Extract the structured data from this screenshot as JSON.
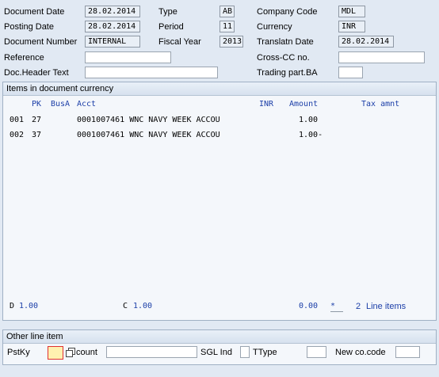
{
  "header": {
    "document_date": {
      "label": "Document Date",
      "value": "28.02.2014"
    },
    "posting_date": {
      "label": "Posting Date",
      "value": "28.02.2014"
    },
    "document_number": {
      "label": "Document Number",
      "value": "INTERNAL"
    },
    "reference": {
      "label": "Reference",
      "value": ""
    },
    "doc_header_text": {
      "label": "Doc.Header Text",
      "value": ""
    },
    "type": {
      "label": "Type",
      "value": "AB"
    },
    "period": {
      "label": "Period",
      "value": "11"
    },
    "fiscal_year": {
      "label": "Fiscal Year",
      "value": "2013"
    },
    "company_code": {
      "label": "Company Code",
      "value": "MDL"
    },
    "currency": {
      "label": "Currency",
      "value": "INR"
    },
    "translatn_date": {
      "label": "Translatn Date",
      "value": "28.02.2014"
    },
    "cross_cc": {
      "label": "Cross-CC no.",
      "value": ""
    },
    "trading_part": {
      "label": "Trading part.BA",
      "value": ""
    }
  },
  "items_panel": {
    "title": "Items in document currency",
    "columns": {
      "pk": "PK",
      "busa": "BusA",
      "acct": "Acct",
      "inr": "INR",
      "amount": "Amount",
      "tax": "Tax amnt"
    },
    "rows": [
      {
        "item": "001",
        "pk": "27",
        "acct": "0001007461 WNC NAVY WEEK ACCOU",
        "amount": "1.00"
      },
      {
        "item": "002",
        "pk": "37",
        "acct": "0001007461 WNC NAVY WEEK ACCOU",
        "amount": "1.00-"
      }
    ],
    "footer": {
      "d_label": "D",
      "d_value": "1.00",
      "c_label": "C",
      "c_value": "1.00",
      "balance": "0.00",
      "star": "*",
      "line_count": "2",
      "line_items_label": "Line items"
    }
  },
  "other_panel": {
    "title": "Other line item",
    "pstky_label": "PstKy",
    "pstky_value": "",
    "account_label": "count",
    "account_value": "",
    "sgl_label": "SGL Ind",
    "sgl_value": "",
    "ttype_label": "TType",
    "ttype_value": "",
    "newco_label": "New co.code",
    "newco_value": ""
  },
  "colors": {
    "bg": "#e1e9f3",
    "panel_border": "#9fb0c4",
    "blue_text": "#1c3fa8",
    "focus": "#e03030"
  }
}
